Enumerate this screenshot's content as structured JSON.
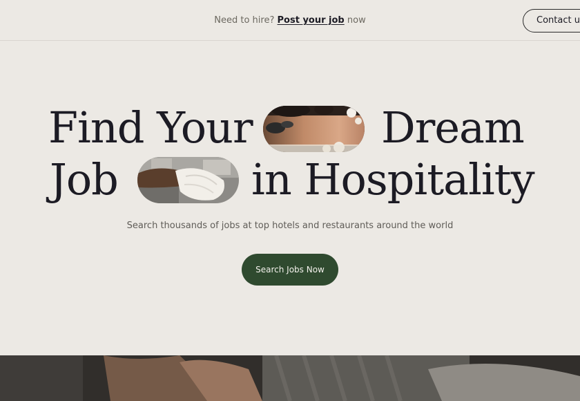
{
  "header": {
    "hire_prefix": "Need to hire?",
    "post_job_link": "Post your job",
    "hire_suffix": "now",
    "contact_label": "Contact us"
  },
  "hero": {
    "line1_word1": "Find Your",
    "line1_word2": "Dream",
    "line2_word1": "Job",
    "line2_word2": "in Hospitality",
    "subtitle": "Search thousands of jobs at top hotels and restaurants around the world",
    "cta_label": "Search Jobs Now"
  },
  "colors": {
    "background": "#ece9e4",
    "text": "#1c1b24",
    "cta_background": "#2f4a2f",
    "cta_text": "#f3f1ec"
  }
}
